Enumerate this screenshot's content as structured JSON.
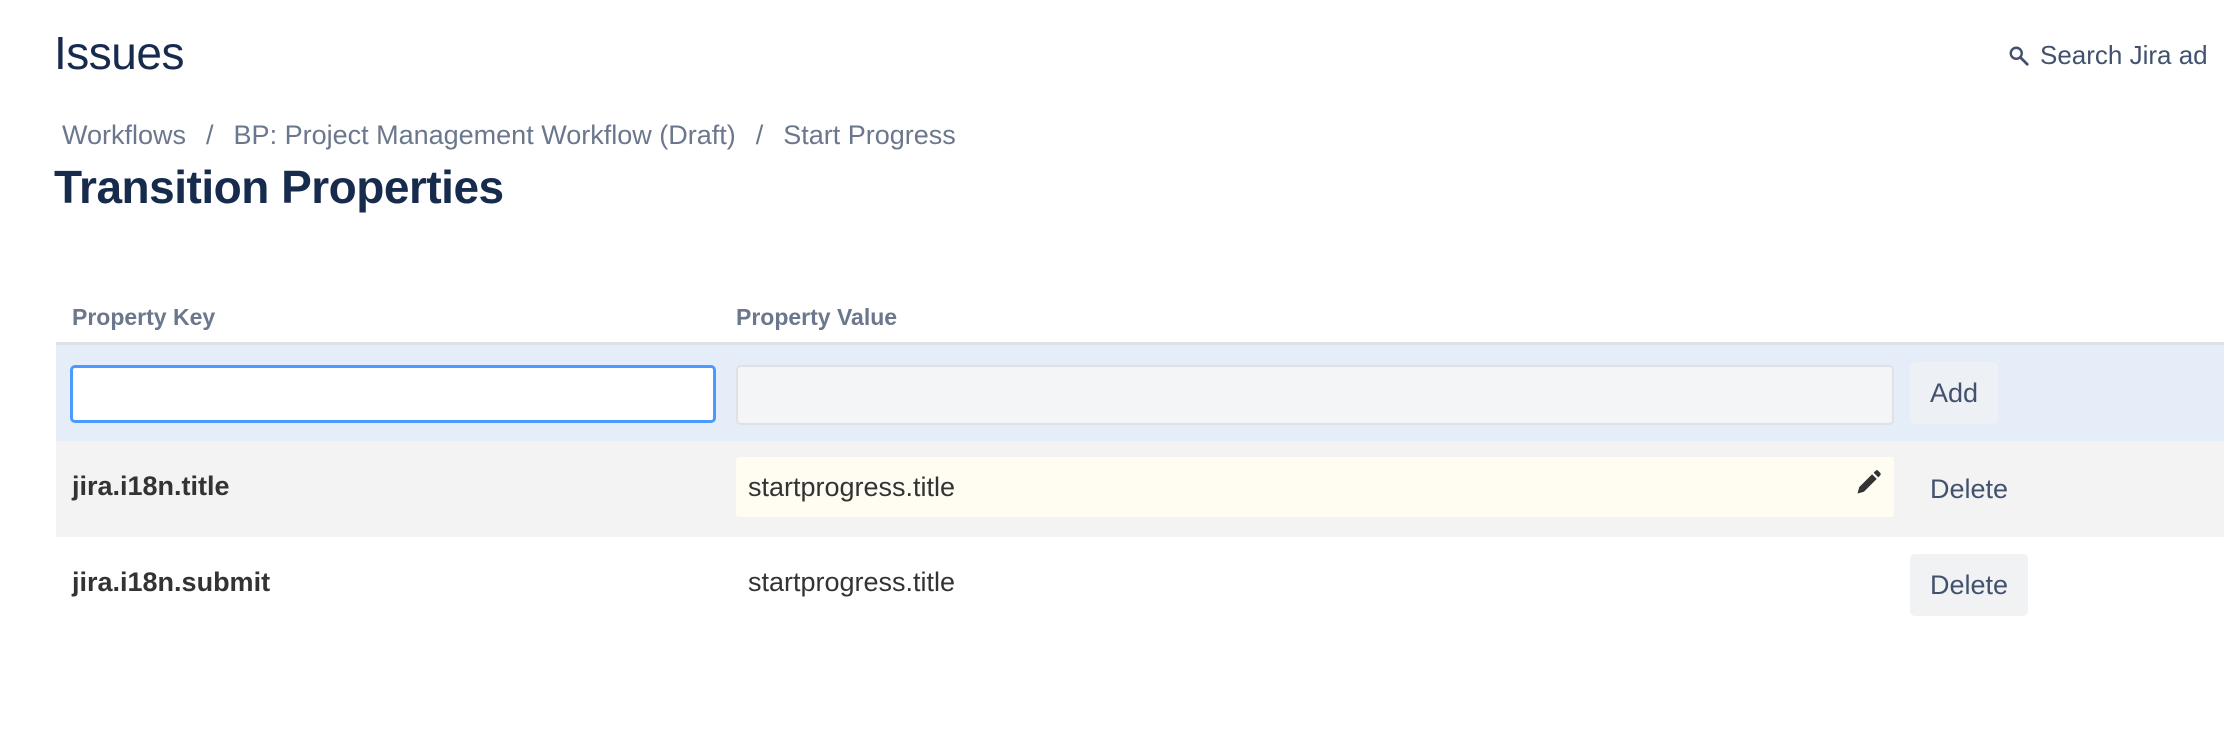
{
  "header": {
    "app_title": "Issues",
    "search_label": "Search Jira ad"
  },
  "breadcrumb": {
    "items": [
      "Workflows",
      "BP: Project Management Workflow (Draft)",
      "Start Progress"
    ],
    "separator": "/"
  },
  "page": {
    "title": "Transition Properties"
  },
  "table": {
    "columns": [
      "Property Key",
      "Property Value"
    ],
    "new_row": {
      "key_value": "",
      "value_value": "",
      "add_label": "Add"
    },
    "rows": [
      {
        "key": "jira.i18n.title",
        "value": "startprogress.title",
        "delete_label": "Delete"
      },
      {
        "key": "jira.i18n.submit",
        "value": "startprogress.title",
        "delete_label": "Delete"
      }
    ]
  },
  "icons": {
    "search": "search-icon",
    "edit": "pencil-icon"
  },
  "colors": {
    "focus_border": "#4c9aff",
    "add_row_bg": "#e4edf8",
    "editable_bg": "#fffdf2"
  }
}
